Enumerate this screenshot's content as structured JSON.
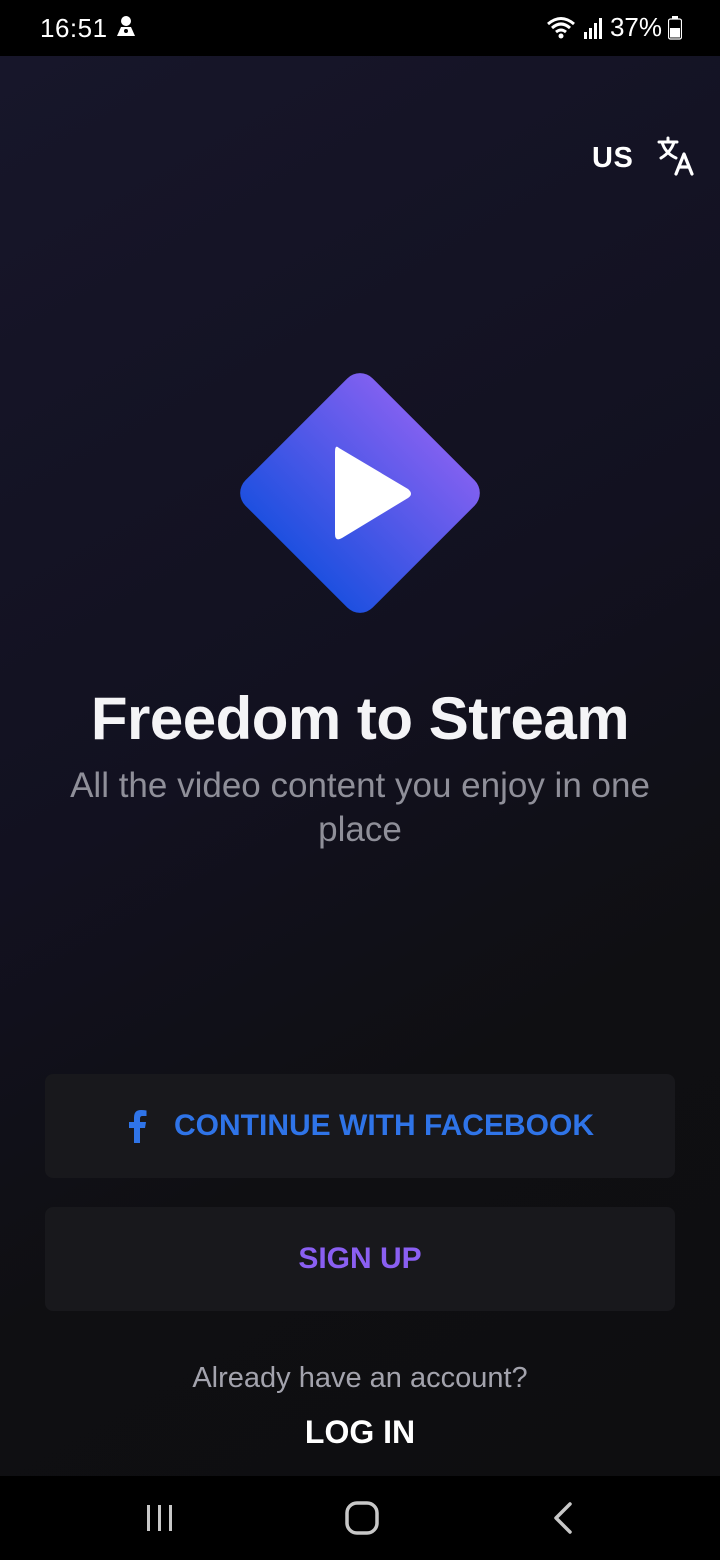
{
  "status_bar": {
    "time": "16:51",
    "battery": "37%",
    "icons": [
      "notification-icon",
      "wifi-icon",
      "signal-icon",
      "battery-icon"
    ]
  },
  "header": {
    "region": "US",
    "language_icon": "translate-icon"
  },
  "hero": {
    "logo_icon": "play-diamond-logo",
    "title": "Freedom to Stream",
    "subtitle": "All the video content you enjoy in one place"
  },
  "actions": {
    "facebook_icon": "facebook-icon",
    "facebook_label": "CONTINUE WITH FACEBOOK",
    "signup_label": "SIGN UP",
    "login_prompt": "Already have an account?",
    "login_label": "LOG IN"
  },
  "nav_bar": {
    "icons": [
      "recents-icon",
      "home-icon",
      "back-icon"
    ]
  },
  "colors": {
    "background": "#111018",
    "facebook_blue": "#2f74e8",
    "signup_purple": "#8a5ff2",
    "logo_top": "#8060f0",
    "logo_bottom": "#1e50e0"
  }
}
